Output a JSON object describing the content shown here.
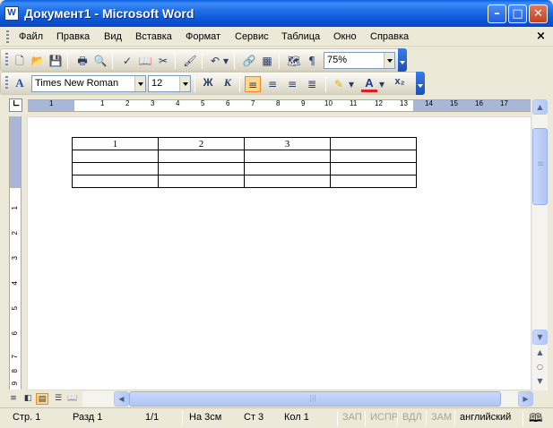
{
  "window": {
    "title": "Документ1 - Microsoft Word",
    "app_icon": "W"
  },
  "menu": [
    "Файл",
    "Правка",
    "Вид",
    "Вставка",
    "Формат",
    "Сервис",
    "Таблица",
    "Окно",
    "Справка"
  ],
  "toolbar_standard": {
    "zoom": "75%"
  },
  "toolbar_format": {
    "style_glyph": "A",
    "font": "Times New Roman",
    "size": "12"
  },
  "ruler": {
    "h_ticks": [
      "1",
      "1",
      "2",
      "3",
      "4",
      "5",
      "6",
      "7",
      "8",
      "9",
      "10",
      "11",
      "12",
      "13",
      "14",
      "15",
      "16",
      "17"
    ],
    "v_ticks": [
      "1",
      "2",
      "3",
      "4",
      "5",
      "6",
      "7",
      "8",
      "9"
    ]
  },
  "document": {
    "table": [
      [
        "1",
        "2",
        "3",
        ""
      ],
      [
        "",
        "",
        "",
        ""
      ],
      [
        "",
        "",
        "",
        ""
      ],
      [
        "",
        "",
        "",
        ""
      ]
    ]
  },
  "status": {
    "page": "Стр.  1",
    "section": "Разд  1",
    "pages": "1/1",
    "position": "На  3см",
    "line": "Ст  3",
    "column": "Кол  1",
    "rec": "ЗАП",
    "trk": "ИСПР",
    "ext": "ВДЛ",
    "ovr": "ЗАМ",
    "language": "английский"
  },
  "colors": {
    "title_bar": "#0b54d4",
    "chrome": "#ece9d8",
    "active_button": "#fbd78e",
    "ruler_margin": "#a8b6d8"
  }
}
